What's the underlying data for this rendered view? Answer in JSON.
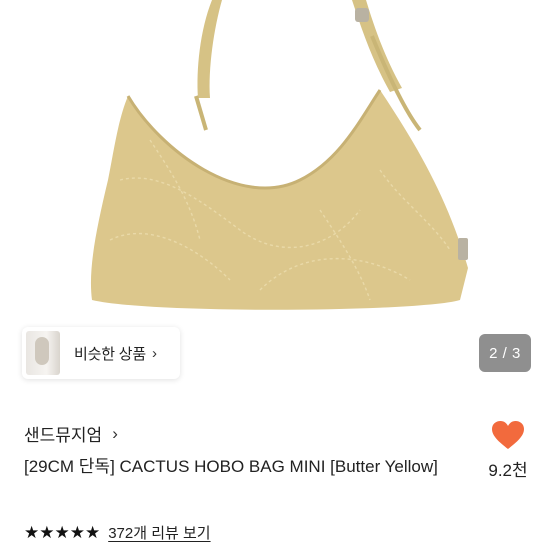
{
  "product_image": {
    "alt": "CACTUS HOBO BAG MINI Butter Yellow",
    "color": "#d9c58b"
  },
  "similar": {
    "label": "비슷한 상품",
    "chevron": "›"
  },
  "pager": {
    "text": "2 / 3"
  },
  "brand": {
    "name": "샌드뮤지엄",
    "chevron": "›"
  },
  "product": {
    "title": "[29CM 단독] CACTUS HOBO BAG MINI [Butter Yellow]"
  },
  "like": {
    "icon": "heart-icon",
    "color": "#f26a3d",
    "count": "9.2천"
  },
  "rating": {
    "stars": "★★★★★",
    "reviews_label": "372개 리뷰 보기"
  }
}
